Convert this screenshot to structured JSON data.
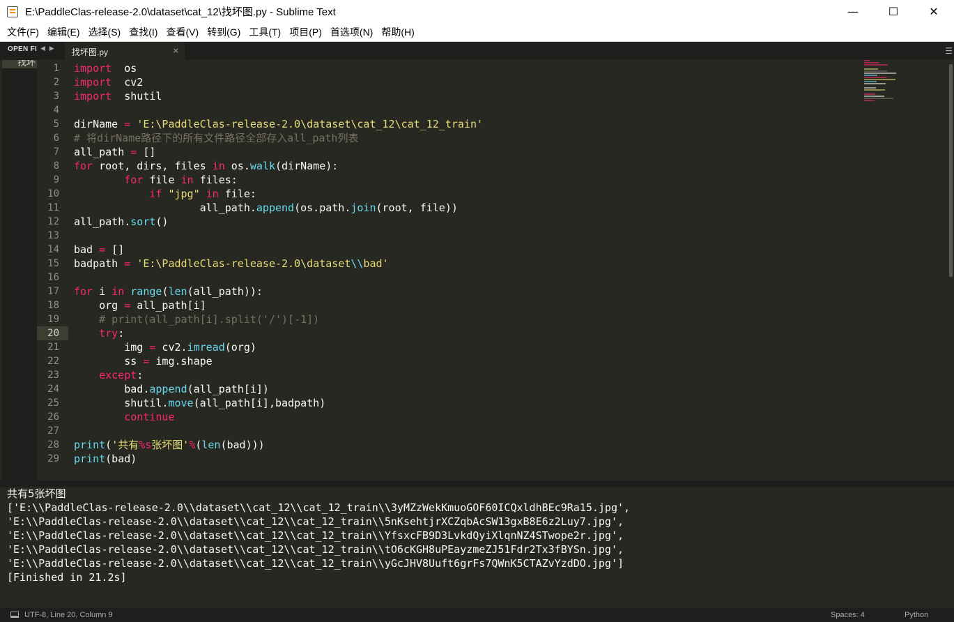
{
  "window": {
    "title": "E:\\PaddleClas-release-2.0\\dataset\\cat_12\\找坏图.py - Sublime Text",
    "controls": {
      "minimize": "—",
      "maximize": "☐",
      "close": "✕"
    }
  },
  "menu": [
    {
      "label": "文件(F)"
    },
    {
      "label": "编辑(E)"
    },
    {
      "label": "选择(S)"
    },
    {
      "label": "查找(I)"
    },
    {
      "label": "查看(V)"
    },
    {
      "label": "转到(G)"
    },
    {
      "label": "工具(T)"
    },
    {
      "label": "项目(P)"
    },
    {
      "label": "首选项(N)"
    },
    {
      "label": "帮助(H)"
    }
  ],
  "sidebar": {
    "title": "OPEN FI",
    "file": "找坏"
  },
  "tabs": [
    {
      "label": "找坏图.py",
      "active": true,
      "close": "×"
    }
  ],
  "editor": {
    "active_line": 20,
    "lines": [
      {
        "n": "1",
        "tokens": [
          [
            "kw",
            "import"
          ],
          [
            "",
            "  os"
          ]
        ]
      },
      {
        "n": "2",
        "tokens": [
          [
            "kw",
            "import"
          ],
          [
            "",
            "  cv2"
          ]
        ]
      },
      {
        "n": "3",
        "tokens": [
          [
            "kw",
            "import"
          ],
          [
            "",
            "  shutil"
          ]
        ]
      },
      {
        "n": "4",
        "tokens": []
      },
      {
        "n": "5",
        "tokens": [
          [
            "",
            "dirName "
          ],
          [
            "op",
            "="
          ],
          [
            "",
            " "
          ],
          [
            "str",
            "'E:\\PaddleClas-release-2.0\\dataset\\cat_12\\cat_12_train'"
          ]
        ]
      },
      {
        "n": "6",
        "tokens": [
          [
            "cm",
            "# 将dirName路径下的所有文件路径全部存入all_path列表"
          ]
        ]
      },
      {
        "n": "7",
        "tokens": [
          [
            "",
            "all_path "
          ],
          [
            "op",
            "="
          ],
          [
            "",
            " []"
          ]
        ]
      },
      {
        "n": "8",
        "tokens": [
          [
            "kw",
            "for"
          ],
          [
            "",
            " root, dirs, files "
          ],
          [
            "kw",
            "in"
          ],
          [
            "",
            " os."
          ],
          [
            "fn",
            "walk"
          ],
          [
            "",
            "(dirName):"
          ]
        ]
      },
      {
        "n": "9",
        "tokens": [
          [
            "",
            "        "
          ],
          [
            "kw",
            "for"
          ],
          [
            "",
            " file "
          ],
          [
            "kw",
            "in"
          ],
          [
            "",
            " files:"
          ]
        ]
      },
      {
        "n": "10",
        "tokens": [
          [
            "",
            "            "
          ],
          [
            "kw",
            "if"
          ],
          [
            "",
            " "
          ],
          [
            "str",
            "\"jpg\""
          ],
          [
            "",
            " "
          ],
          [
            "kw",
            "in"
          ],
          [
            "",
            " file:"
          ]
        ]
      },
      {
        "n": "11",
        "tokens": [
          [
            "",
            "                    all_path."
          ],
          [
            "fn",
            "append"
          ],
          [
            "",
            "(os.path."
          ],
          [
            "fn",
            "join"
          ],
          [
            "",
            "(root, file))"
          ]
        ]
      },
      {
        "n": "12",
        "tokens": [
          [
            "",
            "all_path."
          ],
          [
            "fn",
            "sort"
          ],
          [
            "",
            "()"
          ]
        ]
      },
      {
        "n": "13",
        "tokens": []
      },
      {
        "n": "14",
        "tokens": [
          [
            "",
            "bad "
          ],
          [
            "op",
            "="
          ],
          [
            "",
            " []"
          ]
        ]
      },
      {
        "n": "15",
        "tokens": [
          [
            "",
            "badpath "
          ],
          [
            "op",
            "="
          ],
          [
            "",
            " "
          ],
          [
            "str",
            "'E:\\PaddleClas-release-2.0\\dataset"
          ],
          [
            "fn",
            "\\\\"
          ],
          [
            "str",
            "bad'"
          ]
        ]
      },
      {
        "n": "16",
        "tokens": []
      },
      {
        "n": "17",
        "tokens": [
          [
            "kw",
            "for"
          ],
          [
            "",
            " i "
          ],
          [
            "kw",
            "in"
          ],
          [
            "",
            " "
          ],
          [
            "fn",
            "range"
          ],
          [
            "",
            "("
          ],
          [
            "fn",
            "len"
          ],
          [
            "",
            "(all_path)):"
          ]
        ]
      },
      {
        "n": "18",
        "tokens": [
          [
            "",
            "    org "
          ],
          [
            "op",
            "="
          ],
          [
            "",
            " all_path[i]"
          ]
        ]
      },
      {
        "n": "19",
        "tokens": [
          [
            "",
            "    "
          ],
          [
            "cm",
            "# print(all_path[i].split('/')[-1])"
          ]
        ]
      },
      {
        "n": "20",
        "tokens": [
          [
            "",
            "    "
          ],
          [
            "kw",
            "try"
          ],
          [
            "",
            ":"
          ]
        ]
      },
      {
        "n": "21",
        "tokens": [
          [
            "",
            "        img "
          ],
          [
            "op",
            "="
          ],
          [
            "",
            " cv2."
          ],
          [
            "fn",
            "imread"
          ],
          [
            "",
            "(org)"
          ]
        ]
      },
      {
        "n": "22",
        "tokens": [
          [
            "",
            "        ss "
          ],
          [
            "op",
            "="
          ],
          [
            "",
            " img.shape"
          ]
        ]
      },
      {
        "n": "23",
        "tokens": [
          [
            "",
            "    "
          ],
          [
            "kw",
            "except"
          ],
          [
            "",
            ":"
          ]
        ]
      },
      {
        "n": "24",
        "tokens": [
          [
            "",
            "        bad."
          ],
          [
            "fn",
            "append"
          ],
          [
            "",
            "(all_path[i])"
          ]
        ]
      },
      {
        "n": "25",
        "tokens": [
          [
            "",
            "        shutil."
          ],
          [
            "fn",
            "move"
          ],
          [
            "",
            "(all_path[i],badpath)"
          ]
        ]
      },
      {
        "n": "26",
        "tokens": [
          [
            "",
            "        "
          ],
          [
            "kw",
            "continue"
          ]
        ]
      },
      {
        "n": "27",
        "tokens": []
      },
      {
        "n": "28",
        "tokens": [
          [
            "fn",
            "print"
          ],
          [
            "",
            "("
          ],
          [
            "str",
            "'共有"
          ],
          [
            "op",
            "%s"
          ],
          [
            "str",
            "张坏图'"
          ],
          [
            "op",
            "%"
          ],
          [
            "",
            "("
          ],
          [
            "fn",
            "len"
          ],
          [
            "",
            "(bad)))"
          ]
        ]
      },
      {
        "n": "29",
        "tokens": [
          [
            "fn",
            "print"
          ],
          [
            "",
            "(bad)"
          ]
        ]
      }
    ]
  },
  "output": [
    "共有5张坏图",
    "['E:\\\\PaddleClas-release-2.0\\\\dataset\\\\cat_12\\\\cat_12_train\\\\3yMZzWekKmuoGOF60ICQxldhBEc9Ra15.jpg',",
    "'E:\\\\PaddleClas-release-2.0\\\\dataset\\\\cat_12\\\\cat_12_train\\\\5nKsehtjrXCZqbAcSW13gxB8E6z2Luy7.jpg',",
    "'E:\\\\PaddleClas-release-2.0\\\\dataset\\\\cat_12\\\\cat_12_train\\\\YfsxcFB9D3LvkdQyiXlqnNZ4STwope2r.jpg',",
    "'E:\\\\PaddleClas-release-2.0\\\\dataset\\\\cat_12\\\\cat_12_train\\\\tO6cKGH8uPEayzmeZJ51Fdr2Tx3fBYSn.jpg',",
    "'E:\\\\PaddleClas-release-2.0\\\\dataset\\\\cat_12\\\\cat_12_train\\\\yGcJHV8Uuft6grFs7QWnK5CTAZvYzdDO.jpg']",
    "[Finished in 21.2s]"
  ],
  "status": {
    "left": "UTF-8, Line 20, Column 9",
    "spaces": "Spaces: 4",
    "syntax": "Python"
  },
  "colors": {
    "background": "#272822",
    "keyword": "#f92672",
    "function": "#66d9ef",
    "string": "#e6db74",
    "comment": "#75715e",
    "foreground": "#f8f8f2"
  }
}
